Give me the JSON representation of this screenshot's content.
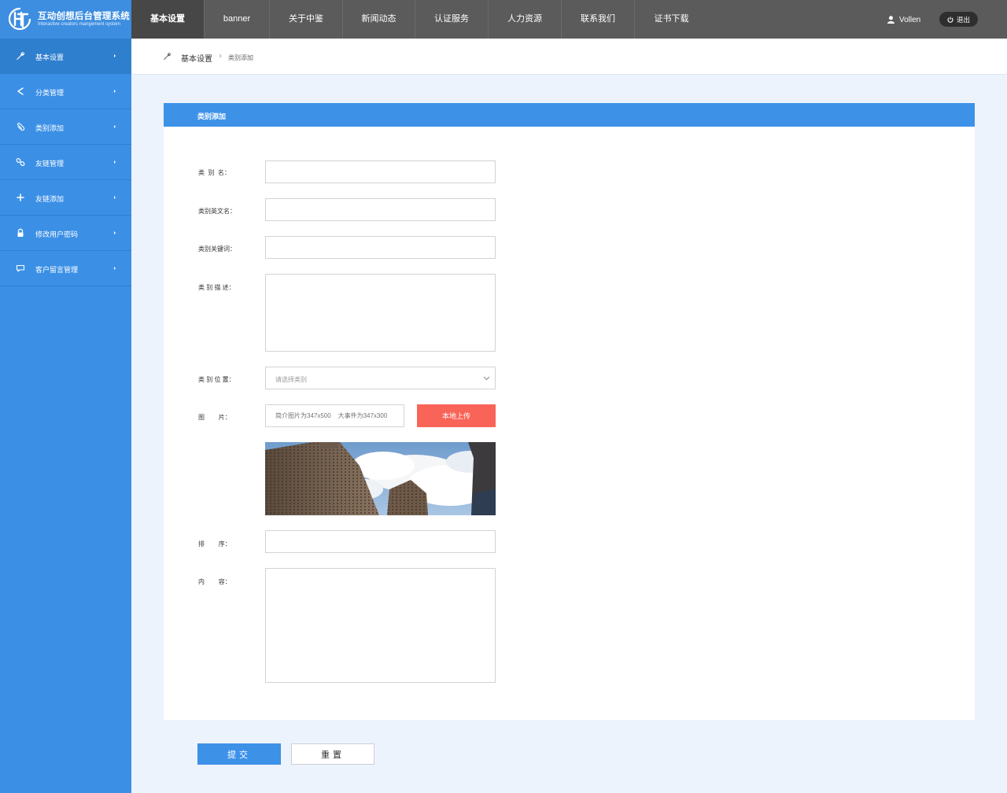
{
  "brand": {
    "title": "互动创想后台管理系统",
    "subtitle": "Interactive creators mangement system",
    "logo_text": "HT"
  },
  "topnav": {
    "items": [
      {
        "label": "基本设置",
        "active": true
      },
      {
        "label": "banner",
        "active": false
      },
      {
        "label": "关于中鉴",
        "active": false
      },
      {
        "label": "新闻动态",
        "active": false
      },
      {
        "label": "认证服务",
        "active": false
      },
      {
        "label": "人力资源",
        "active": false
      },
      {
        "label": "联系我们",
        "active": false
      },
      {
        "label": "证书下载",
        "active": false
      }
    ]
  },
  "user": {
    "name": "Vollen",
    "icon": "user-icon"
  },
  "logout": {
    "label": "退出",
    "icon": "power-icon"
  },
  "sidebar": {
    "items": [
      {
        "label": "基本设置",
        "icon": "wrench-icon",
        "active": true
      },
      {
        "label": "分类管理",
        "icon": "share-icon",
        "active": false
      },
      {
        "label": "类别添加",
        "icon": "paperclip-icon",
        "active": false
      },
      {
        "label": "友链管理",
        "icon": "link-icon",
        "active": false
      },
      {
        "label": "友链添加",
        "icon": "plus-icon",
        "active": false
      },
      {
        "label": "修改用户密码",
        "icon": "lock-icon",
        "active": false
      },
      {
        "label": "客户留言管理",
        "icon": "comment-icon",
        "active": false
      }
    ]
  },
  "breadcrumb": {
    "main": "基本设置",
    "sub": "类别添加",
    "icon": "wrench-icon"
  },
  "panel": {
    "title": "类别添加"
  },
  "form": {
    "name_label": "类  别  名：",
    "en_name_label": "类别英文名：",
    "keywords_label": "类别关键词：",
    "desc_label": "类 别 描 述：",
    "position_label": "类 别 位 置：",
    "position_placeholder": "请选择类别",
    "image_label": "图        片：",
    "image_placeholder": "简介图片为347x500    大事件为347x300",
    "upload_label": "本地上传",
    "sort_label": "排        序：",
    "content_label": "内        容："
  },
  "actions": {
    "submit": "提交",
    "reset": "重置"
  },
  "colors": {
    "topbar": "#5b5b5b",
    "sidebar": "#3b90e6",
    "accent": "#3d92e8",
    "upload": "#f96458",
    "background": "#edf3fc"
  }
}
